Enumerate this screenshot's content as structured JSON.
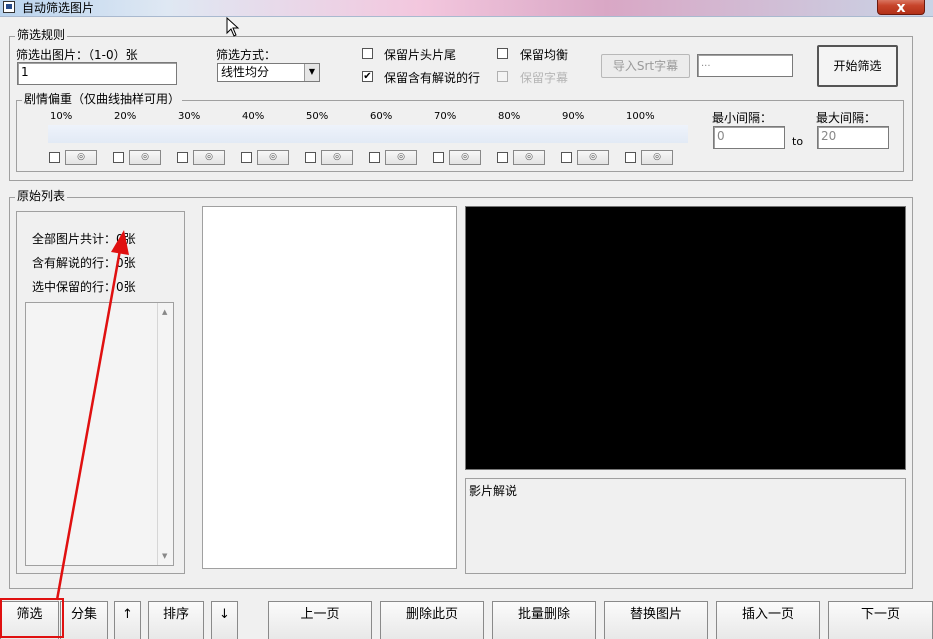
{
  "window": {
    "title": "自动筛选图片",
    "close_label": "x"
  },
  "rules": {
    "legend": "筛选规则",
    "count_label": "筛选出图片：（1-0）张",
    "count_value": "1",
    "method_label": "筛选方式：",
    "method_value": "线性均分",
    "keep_head_tail": {
      "label": "保留片头片尾",
      "checked": false
    },
    "keep_commented": {
      "label": "保留含有解说的行",
      "checked": true,
      "mark": "✔"
    },
    "keep_balance": {
      "label": "保留均衡",
      "checked": false
    },
    "keep_subtitle": {
      "label": "保留字幕",
      "checked": false
    },
    "import_srt_label": "导入Srt字幕",
    "srt_path_value": "...",
    "start_button_label": "开始筛选"
  },
  "curve": {
    "legend": "剧情偏重（仅曲线抽样可用）",
    "percents": [
      "10%",
      "20%",
      "30%",
      "40%",
      "50%",
      "60%",
      "70%",
      "80%",
      "90%",
      "100%"
    ],
    "radio_glyph": "◎",
    "min_gap_label": "最小间隔：",
    "min_gap_value": "0",
    "to_label": "to",
    "max_gap_label": "最大间隔：",
    "max_gap_value": "20"
  },
  "source": {
    "legend": "原始列表",
    "total_label": "全部图片共计：0张",
    "commented_label": "含有解说的行：0张",
    "selected_label": "选中保留的行：0张",
    "scroll_up": "▲",
    "scroll_down": "▼",
    "description_label": "影片解说"
  },
  "toolbar": {
    "filter": "筛选",
    "split": "分集",
    "up": "↑",
    "sort": "排序",
    "down": "↓",
    "prev_page": "上一页",
    "delete_page": "删除此页",
    "batch_delete": "批量删除",
    "replace_image": "替换图片",
    "insert_page": "插入一页",
    "next_page": "下一页"
  },
  "colors": {
    "annotation": "#e01010",
    "window_bg": "#f0f0f0",
    "preview_bg": "#000000"
  }
}
